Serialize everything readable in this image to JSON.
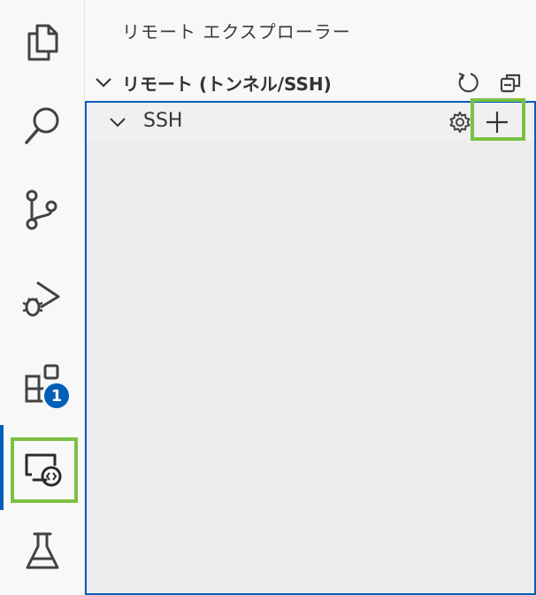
{
  "activity_bar": {
    "items": [
      {
        "icon": "files-icon"
      },
      {
        "icon": "search-icon"
      },
      {
        "icon": "source-control-icon"
      },
      {
        "icon": "run-debug-icon"
      },
      {
        "icon": "extensions-icon",
        "badge": "1"
      },
      {
        "icon": "remote-explorer-icon",
        "active": true
      },
      {
        "icon": "testing-icon"
      }
    ]
  },
  "sidebar": {
    "title": "リモート エクスプローラー",
    "section": {
      "title": "リモート (トンネル/SSH)",
      "actions": [
        "refresh-icon",
        "collapse-all-icon"
      ]
    },
    "tree": {
      "items": [
        {
          "label": "SSH",
          "actions": [
            "gear-icon",
            "plus-icon"
          ]
        }
      ]
    }
  },
  "colors": {
    "accent": "#005fb8",
    "highlight": "#7cc142",
    "icon": "#424242"
  }
}
